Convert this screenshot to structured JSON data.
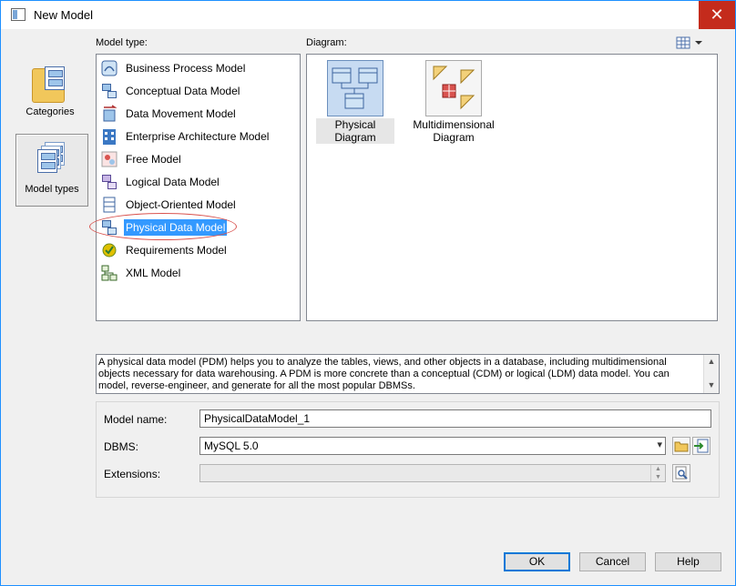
{
  "window": {
    "title": "New Model",
    "close_glyph": "✕"
  },
  "sidebar": {
    "items": [
      {
        "label": "Categories",
        "icon": "folder-icon"
      },
      {
        "label": "Model types",
        "icon": "model-types-icon",
        "active": true
      }
    ]
  },
  "model_type": {
    "label": "Model type:",
    "items": [
      {
        "label": "Business Process Model",
        "icon": "business-process-icon"
      },
      {
        "label": "Conceptual Data Model",
        "icon": "conceptual-data-icon"
      },
      {
        "label": "Data Movement Model",
        "icon": "data-movement-icon"
      },
      {
        "label": "Enterprise Architecture Model",
        "icon": "enterprise-architecture-icon"
      },
      {
        "label": "Free Model",
        "icon": "free-model-icon"
      },
      {
        "label": "Logical Data Model",
        "icon": "logical-data-icon"
      },
      {
        "label": "Object-Oriented Model",
        "icon": "object-oriented-icon"
      },
      {
        "label": "Physical Data Model",
        "icon": "physical-data-icon",
        "selected": true
      },
      {
        "label": "Requirements Model",
        "icon": "requirements-icon"
      },
      {
        "label": "XML Model",
        "icon": "xml-model-icon"
      }
    ]
  },
  "diagram": {
    "label": "Diagram:",
    "items": [
      {
        "label": "Physical Diagram",
        "icon": "physical-diagram-icon",
        "selected": true
      },
      {
        "label": "Multidimensional Diagram",
        "icon": "multidimensional-diagram-icon"
      }
    ]
  },
  "description": "A physical data model (PDM) helps you to analyze the tables, views, and other objects in a database, including multidimensional objects necessary for data warehousing. A PDM is more concrete than a conceptual (CDM) or logical (LDM) data model. You can model, reverse-engineer, and generate for all the most popular DBMSs.",
  "form": {
    "model_name_label": "Model name:",
    "model_name_value": "PhysicalDataModel_1",
    "dbms_label": "DBMS:",
    "dbms_value": "MySQL 5.0",
    "extensions_label": "Extensions:",
    "extensions_value": ""
  },
  "buttons": {
    "ok": "OK",
    "cancel": "Cancel",
    "help": "Help"
  },
  "colors": {
    "accent": "#3399ff",
    "window_border": "#1e90ff",
    "close": "#c42b1c"
  }
}
